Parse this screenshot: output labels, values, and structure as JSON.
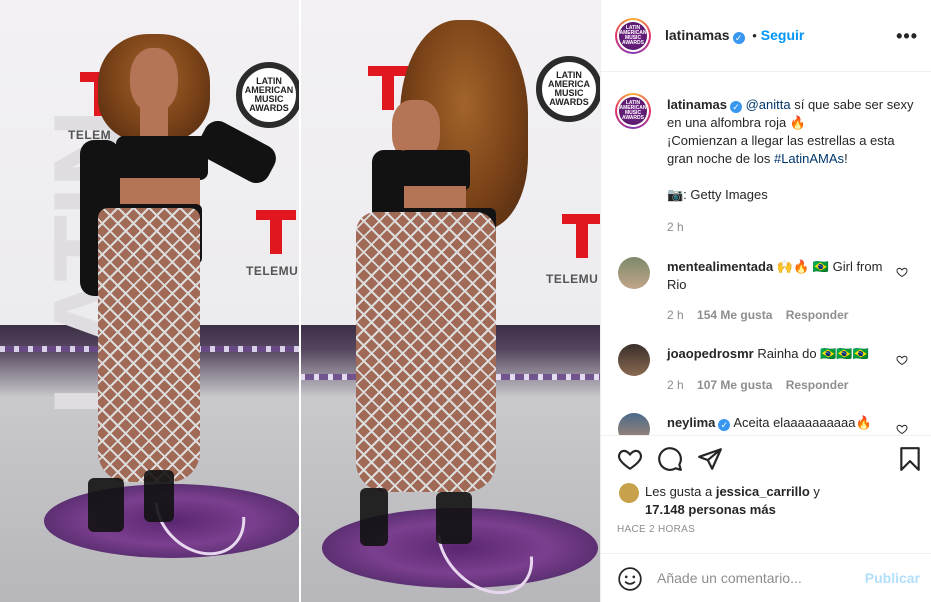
{
  "post": {
    "account": "latinamas",
    "follow_label": "Seguir",
    "more_label": "•••",
    "avatar_text": "LATIN AMERICAN MUSIC AWARDS"
  },
  "photo": {
    "backdrop_word": "LATIN",
    "left_logo": {
      "network": "TELEMUNDO",
      "network_partial": "TELEM",
      "ama": [
        "LATIN",
        "AMERICAN",
        "MUSIC",
        "AWARDS"
      ]
    },
    "right_logo": {
      "network_partial": "TELEMU",
      "ama": [
        "LATIN",
        "AMERICA",
        "MUSIC",
        "AWARDS"
      ]
    }
  },
  "caption": {
    "username": "latinamas",
    "mention": "@anitta",
    "text_1": " sí que sabe ser sexy en una alfombra roja 🔥",
    "text_2": "¡Comienzan a llegar las estrellas a esta gran noche de los ",
    "hashtag": "#LatinAMAs",
    "text_3": "!",
    "credit": "📷: Getty Images",
    "time": "2 h"
  },
  "comments": [
    {
      "username": "mentealimentada",
      "text": "🙌🔥 🇧🇷 Girl from Rio",
      "time": "2 h",
      "likes": "154 Me gusta",
      "reply": "Responder"
    },
    {
      "username": "joaopedrosmr",
      "text": "Rainha do 🇧🇷🇧🇷🇧🇷",
      "time": "2 h",
      "likes": "107 Me gusta",
      "reply": "Responder"
    },
    {
      "username": "neylima",
      "text": "Aceita elaaaaaaaaaa🔥",
      "verified": true
    }
  ],
  "likes": {
    "prefix": "Les gusta a ",
    "first_user": "jessica_carrillo",
    "connector": " y",
    "count": "17.148 personas más"
  },
  "timestamp": "HACE 2 HORAS",
  "comment_box": {
    "placeholder": "Añade un comentario...",
    "publish_label": "Publicar"
  },
  "colors": {
    "accent": "#0095f6",
    "publish_disabled": "#b2dffc",
    "link": "#00376b",
    "muted": "#8e8e8e"
  }
}
